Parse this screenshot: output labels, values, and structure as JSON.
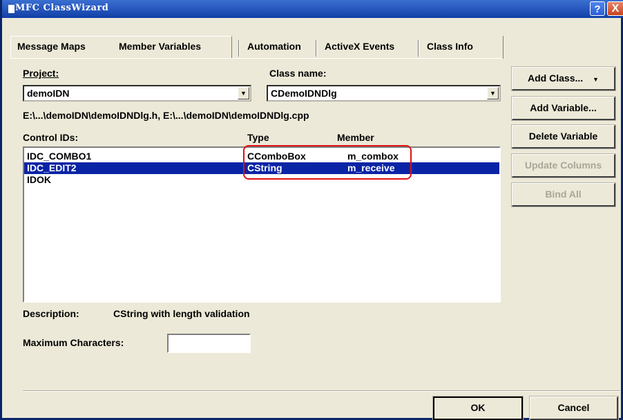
{
  "window": {
    "title": "MFC ClassWizard",
    "help_glyph": "?",
    "close_glyph": "X"
  },
  "tabs": [
    {
      "label": "Message Maps"
    },
    {
      "label": "Member Variables"
    },
    {
      "label": "Automation"
    },
    {
      "label": "ActiveX Events"
    },
    {
      "label": "Class Info"
    }
  ],
  "active_tab": "Member Variables",
  "project": {
    "label": "Project:",
    "value": "demoIDN"
  },
  "class_name": {
    "label": "Class name:",
    "value": "CDemoIDNDlg"
  },
  "file_path": "E:\\...\\demoIDN\\demoIDNDlg.h, E:\\...\\demoIDN\\demoIDNDlg.cpp",
  "columns": {
    "control_ids": "Control IDs:",
    "type": "Type",
    "member": "Member"
  },
  "rows": [
    {
      "id": "IDC_COMBO1",
      "type": "CComboBox",
      "member": "m_combox",
      "selected": false
    },
    {
      "id": "IDC_EDIT2",
      "type": "CString",
      "member": "m_receive",
      "selected": true
    },
    {
      "id": "IDOK",
      "type": "",
      "member": "",
      "selected": false
    }
  ],
  "side_buttons": {
    "add_class": "Add Class...",
    "add_class_arrow": "▼",
    "add_variable": "Add Variable...",
    "delete_variable": "Delete Variable",
    "update_columns": "Update Columns",
    "bind_all": "Bind All"
  },
  "description": {
    "label": "Description:",
    "value": "CString with length validation"
  },
  "max_chars": {
    "label": "Maximum Characters:",
    "value": ""
  },
  "footer": {
    "ok": "OK",
    "cancel": "Cancel"
  },
  "colors": {
    "selection": "#0a24a6",
    "highlight_box": "#e01010",
    "titlebar": "#2a59bf"
  }
}
